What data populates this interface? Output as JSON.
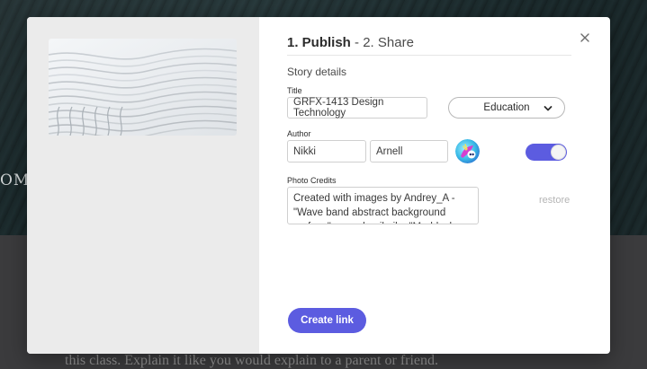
{
  "background": {
    "side_text": "OM",
    "body_text": "this class. Explain it like you would explain to a parent or friend."
  },
  "modal": {
    "steps": {
      "step1": "1. Publish",
      "separator": " - ",
      "step2": "2. Share"
    },
    "close_icon": "close-icon",
    "section_title": "Story details",
    "title_label": "Title",
    "title_value": "GRFX-1413 Design Technology",
    "category": "Education",
    "author_label": "Author",
    "author_first": "Nikki",
    "author_last": "Arnell",
    "avatar_icon": "avatar-icon",
    "toggle_on": true,
    "photo_credits_label": "Photo Credits",
    "photo_credits_value": "Created with images by Andrey_A - \"Wave band abstract background surface\" • pexels • ikaika \"Madduck leaf Photo\"",
    "restore_label": "restore",
    "create_link_label": "Create link"
  },
  "colors": {
    "accent": "#5c5ce0",
    "modal_left_bg": "#ebebeb"
  }
}
